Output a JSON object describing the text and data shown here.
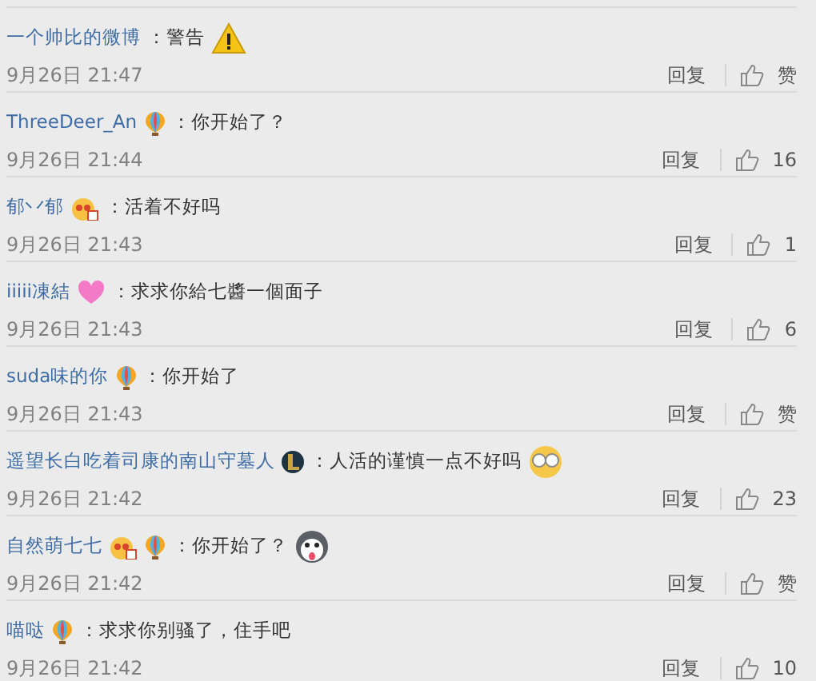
{
  "comments": [
    {
      "author": "一个帅比的微博",
      "text": "：警告",
      "emoji": {
        "kind": "warning"
      },
      "time": "9月26日 21:47",
      "reply": "回复",
      "likes": "赞"
    },
    {
      "author": "ThreeDeer_An",
      "badges": [
        {
          "kind": "balloon"
        }
      ],
      "text": "：你开始了？",
      "time": "9月26日 21:44",
      "reply": "回复",
      "likes": "16"
    },
    {
      "author": "郁丷郁",
      "badges": [
        {
          "kind": "crown"
        }
      ],
      "text": "：活着不好吗",
      "time": "9月26日 21:43",
      "reply": "回复",
      "likes": "1"
    },
    {
      "author": "iiiii凍結",
      "badges": [
        {
          "kind": "heart"
        }
      ],
      "text": "：求求你給七醬一個面子",
      "time": "9月26日 21:43",
      "reply": "回复",
      "likes": "6"
    },
    {
      "author": "suda味的你",
      "badges": [
        {
          "kind": "balloon"
        }
      ],
      "text": "：你开始了",
      "time": "9月26日 21:43",
      "reply": "回复",
      "likes": "赞"
    },
    {
      "author": "遥望长白吃着司康的南山守墓人",
      "badges": [
        {
          "kind": "shield"
        }
      ],
      "text": "：人活的谨慎一点不好吗",
      "emoji": {
        "kind": "glasses"
      },
      "time": "9月26日 21:42",
      "reply": "回复",
      "likes": "23"
    },
    {
      "author": "自然萌七七",
      "badges": [
        {
          "kind": "crown"
        },
        {
          "kind": "balloon"
        }
      ],
      "text": "：你开始了？",
      "emoji": {
        "kind": "husky"
      },
      "time": "9月26日 21:42",
      "reply": "回复",
      "likes": "赞"
    },
    {
      "author": "喵哒",
      "badges": [
        {
          "kind": "balloon"
        }
      ],
      "text": "：求求你别骚了，住手吧",
      "time": "9月26日 21:42",
      "reply": "回复",
      "likes": "10"
    }
  ]
}
